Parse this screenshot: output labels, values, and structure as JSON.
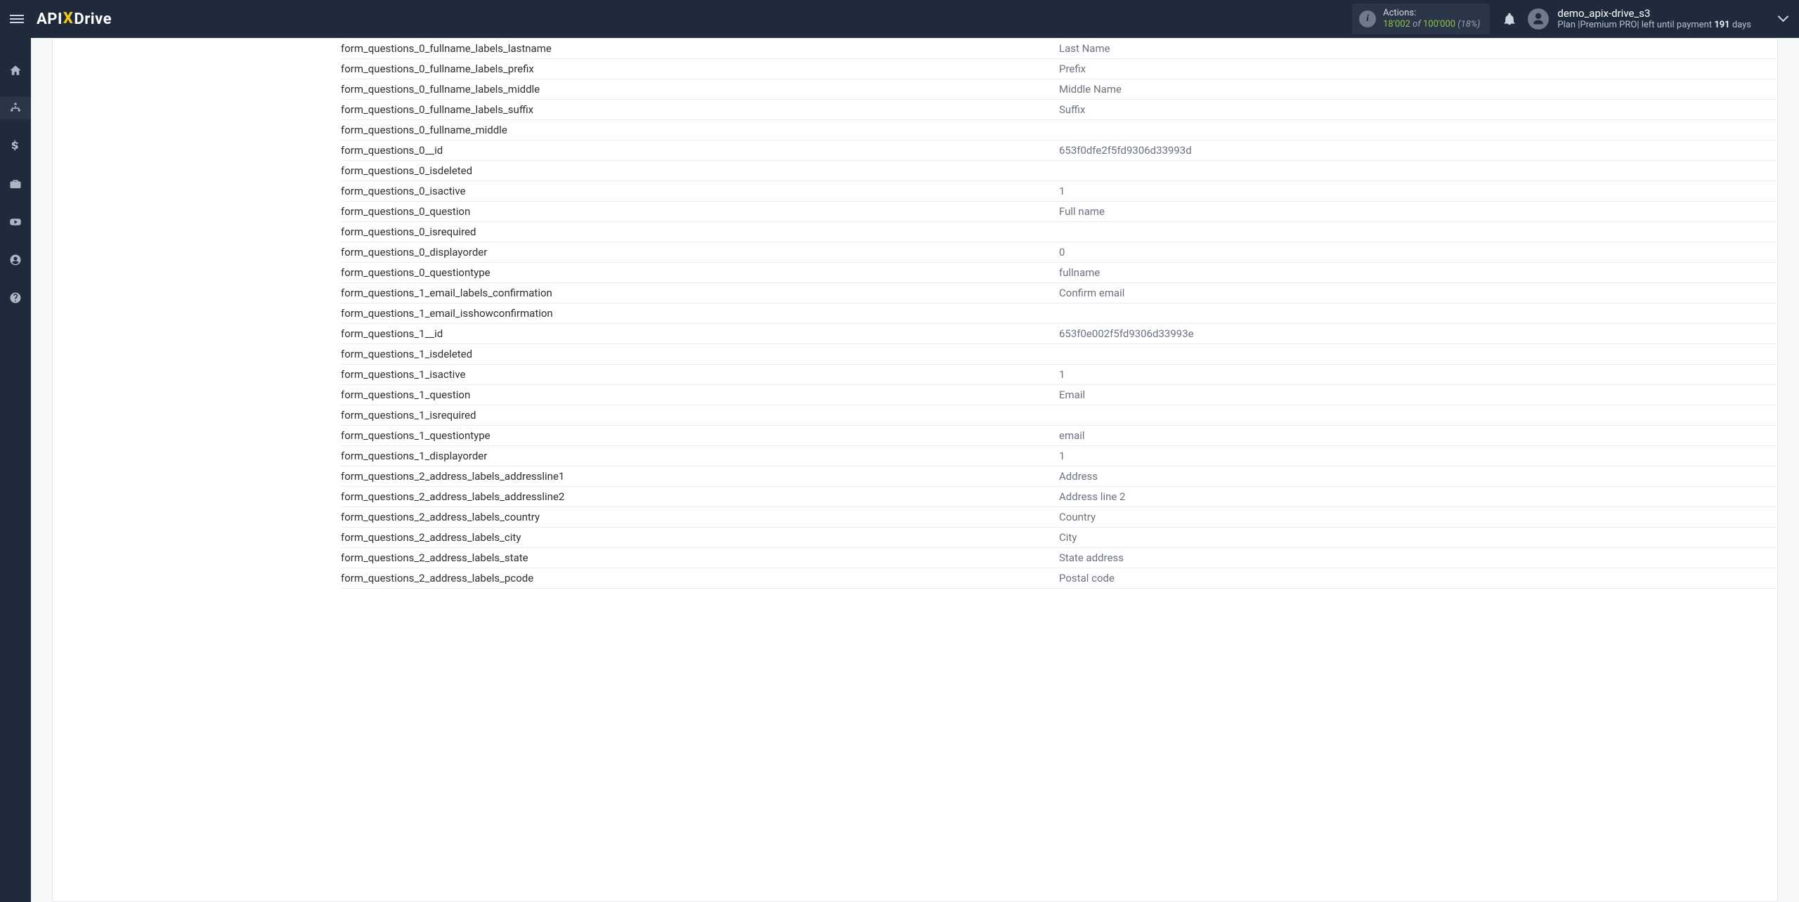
{
  "header": {
    "logo_prefix": "API",
    "logo_x": "X",
    "logo_suffix": "Drive",
    "actions_label": "Actions:",
    "actions_used": "18'002",
    "actions_of": "of",
    "actions_total": "100'000",
    "actions_pct": "(18%)",
    "user_name": "demo_apix-drive_s3",
    "plan_prefix": "Plan |",
    "plan_name": "Premium PRO",
    "plan_mid": "| left until payment ",
    "plan_days": "191",
    "plan_days_suffix": " days"
  },
  "rows": [
    {
      "key": "form_questions_0_fullname_labels_lastname",
      "val": "Last Name"
    },
    {
      "key": "form_questions_0_fullname_labels_prefix",
      "val": "Prefix"
    },
    {
      "key": "form_questions_0_fullname_labels_middle",
      "val": "Middle Name"
    },
    {
      "key": "form_questions_0_fullname_labels_suffix",
      "val": "Suffix"
    },
    {
      "key": "form_questions_0_fullname_middle",
      "val": ""
    },
    {
      "key": "form_questions_0__id",
      "val": "653f0dfe2f5fd9306d33993d"
    },
    {
      "key": "form_questions_0_isdeleted",
      "val": ""
    },
    {
      "key": "form_questions_0_isactive",
      "val": "1"
    },
    {
      "key": "form_questions_0_question",
      "val": "Full name"
    },
    {
      "key": "form_questions_0_isrequired",
      "val": ""
    },
    {
      "key": "form_questions_0_displayorder",
      "val": "0"
    },
    {
      "key": "form_questions_0_questiontype",
      "val": "fullname"
    },
    {
      "key": "form_questions_1_email_labels_confirmation",
      "val": "Confirm email"
    },
    {
      "key": "form_questions_1_email_isshowconfirmation",
      "val": ""
    },
    {
      "key": "form_questions_1__id",
      "val": "653f0e002f5fd9306d33993e"
    },
    {
      "key": "form_questions_1_isdeleted",
      "val": ""
    },
    {
      "key": "form_questions_1_isactive",
      "val": "1"
    },
    {
      "key": "form_questions_1_question",
      "val": "Email"
    },
    {
      "key": "form_questions_1_isrequired",
      "val": ""
    },
    {
      "key": "form_questions_1_questiontype",
      "val": "email"
    },
    {
      "key": "form_questions_1_displayorder",
      "val": "1"
    },
    {
      "key": "form_questions_2_address_labels_addressline1",
      "val": "Address"
    },
    {
      "key": "form_questions_2_address_labels_addressline2",
      "val": "Address line 2"
    },
    {
      "key": "form_questions_2_address_labels_country",
      "val": "Country"
    },
    {
      "key": "form_questions_2_address_labels_city",
      "val": "City"
    },
    {
      "key": "form_questions_2_address_labels_state",
      "val": "State address"
    },
    {
      "key": "form_questions_2_address_labels_pcode",
      "val": "Postal code"
    }
  ]
}
